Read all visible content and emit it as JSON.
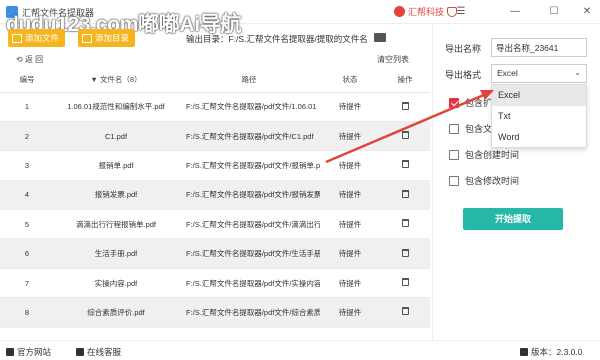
{
  "window": {
    "title": "汇帮文件名提取器",
    "watermark": "dudu123.com嘟嘟Ai导航",
    "vip_label": "汇帮科技",
    "minimize": "—",
    "maximize": "☐",
    "close": "✕"
  },
  "toolbar": {
    "add_files": "添加文件",
    "add_dir": "添加目录",
    "output_dir": "输出目录：F:/S.汇帮文件名提取器/提取的文件名"
  },
  "list": {
    "back": "⟲ 返 回",
    "clear": "清空列表",
    "columns": {
      "index": "编号",
      "filename": "▼ 文件名（8）",
      "path": "路径",
      "status": "状态",
      "action": "操作"
    },
    "rows": [
      {
        "index": "1",
        "name": "1.06.01规范性和编制水平.pdf",
        "path": "F:/S.汇帮文件名提取器/pdf文件/1.06.01",
        "status": "待提件"
      },
      {
        "index": "2",
        "name": "C1.pdf",
        "path": "F:/S.汇帮文件名提取器/pdf文件/C1.pdf",
        "status": "待提件"
      },
      {
        "index": "3",
        "name": "报销单.pdf",
        "path": "F:/S.汇帮文件名提取器/pdf文件/报销单.p",
        "status": "待提件"
      },
      {
        "index": "4",
        "name": "报销发票.pdf",
        "path": "F:/S.汇帮文件名提取器/pdf文件/报销发票",
        "status": "待提件"
      },
      {
        "index": "5",
        "name": "滴滴出行行程报销单.pdf",
        "path": "F:/S.汇帮文件名提取器/pdf文件/滴滴出行",
        "status": "待提件"
      },
      {
        "index": "6",
        "name": "生活手册.pdf",
        "path": "F:/S.汇帮文件名提取器/pdf文件/生活手册",
        "status": "待提件"
      },
      {
        "index": "7",
        "name": "实操内容.pdf",
        "path": "F:/S.汇帮文件名提取器/pdf文件/实操内容",
        "status": "待提件"
      },
      {
        "index": "8",
        "name": "综合素质评价.pdf",
        "path": "F:/S.汇帮文件名提取器/pdf文件/综合素质",
        "status": "待提件"
      }
    ]
  },
  "panel": {
    "export_name_label": "导出名称",
    "export_name_value": "导出名称_23641",
    "export_format_label": "导出格式",
    "export_format_value": "Excel",
    "format_options": [
      "Excel",
      "Txt",
      "Word"
    ],
    "checkboxes": [
      {
        "label": "包含扩",
        "checked": true
      },
      {
        "label": "包含文",
        "checked": false
      },
      {
        "label": "包含创建时间",
        "checked": false
      },
      {
        "label": "包含修改时间",
        "checked": false
      }
    ],
    "start_button": "开始提取"
  },
  "status": {
    "website": "官方网站",
    "support": "在线客服",
    "version": "版本：2.3.0.0"
  },
  "colors": {
    "accent_yellow": "#f5b51c",
    "accent_teal": "#26b7a6",
    "annotation_red": "#e0443b"
  }
}
